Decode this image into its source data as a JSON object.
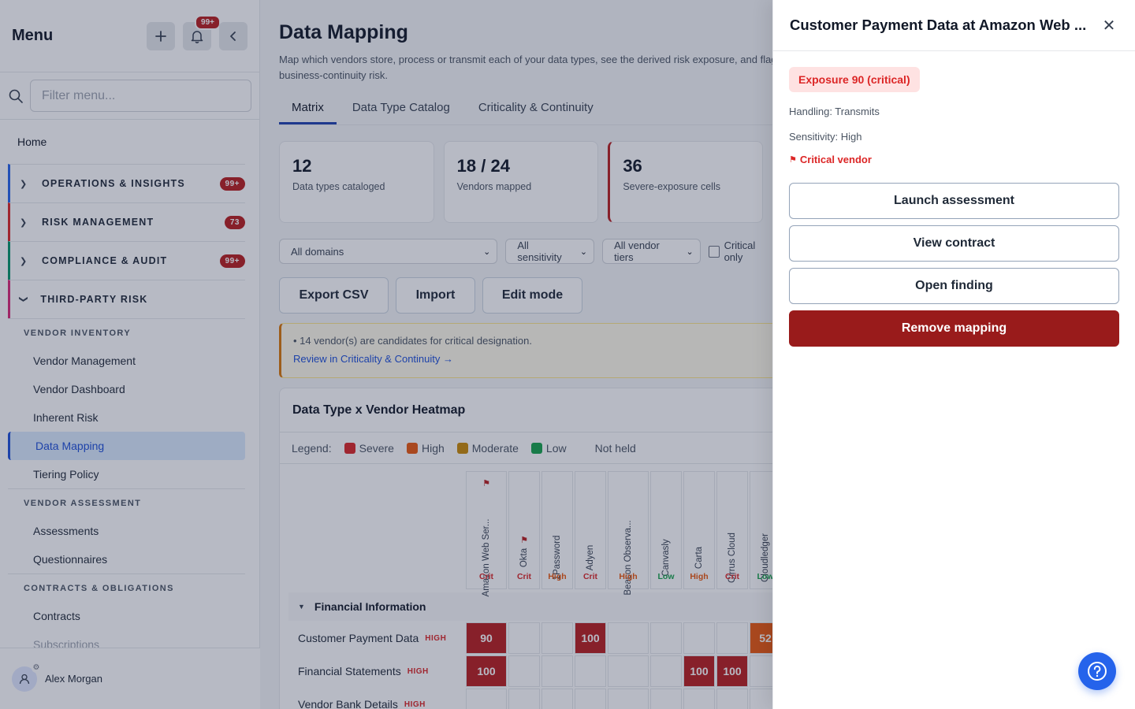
{
  "sidebar": {
    "title": "Menu",
    "notif_badge": "99+",
    "filter_placeholder": "Filter menu...",
    "home": "Home",
    "groups": [
      {
        "label": "OPERATIONS & INSIGHTS",
        "count": "99+",
        "color": "#2563eb",
        "expanded": false
      },
      {
        "label": "RISK MANAGEMENT",
        "count": "73",
        "color": "#dc2626",
        "expanded": false
      },
      {
        "label": "COMPLIANCE & AUDIT",
        "count": "99+",
        "color": "#059669",
        "expanded": false
      },
      {
        "label": "THIRD-PARTY RISK",
        "count": "",
        "color": "#db2777",
        "expanded": true
      }
    ],
    "sections": [
      {
        "label": "VENDOR INVENTORY",
        "items": [
          "Vendor Management",
          "Vendor Dashboard",
          "Inherent Risk",
          "Data Mapping",
          "Tiering Policy"
        ]
      },
      {
        "label": "VENDOR ASSESSMENT",
        "items": [
          "Assessments",
          "Questionnaires"
        ]
      },
      {
        "label": "CONTRACTS & OBLIGATIONS",
        "items": [
          "Contracts",
          "Subscriptions"
        ]
      }
    ],
    "active_item": "Data Mapping",
    "user": "Alex Morgan"
  },
  "main": {
    "title": "Data Mapping",
    "description": "Map which vendors store, process or transmit each of your data types, see the derived risk exposure, and flag business-continuity risk.",
    "tabs": [
      "Matrix",
      "Data Type Catalog",
      "Criticality & Continuity"
    ],
    "active_tab": "Matrix",
    "cards": [
      {
        "value": "12",
        "label": "Data types cataloged"
      },
      {
        "value": "18 / 24",
        "label": "Vendors mapped"
      },
      {
        "value": "36",
        "label": "Severe-exposure cells"
      }
    ],
    "filters": {
      "domains": "All domains",
      "sensitivity": "All sensitivity",
      "tiers": "All vendor tiers",
      "critical_only": "Critical only"
    },
    "actions": [
      "Export CSV",
      "Import",
      "Edit mode"
    ],
    "notice": {
      "text": "• 14 vendor(s) are candidates for critical designation.",
      "link": "Review in Criticality & Continuity →"
    },
    "heatmap": {
      "title": "Data Type x Vendor Heatmap",
      "legend_label": "Legend:",
      "legend": [
        {
          "label": "Severe",
          "color": "#dc2626"
        },
        {
          "label": "High",
          "color": "#ea580c"
        },
        {
          "label": "Moderate",
          "color": "#ca8a04"
        },
        {
          "label": "Low",
          "color": "#16a34a"
        },
        {
          "label": "Not held",
          "color": ""
        }
      ],
      "vendors": [
        {
          "name": "Amazon Web Ser...",
          "tier": "Crit",
          "flag": true
        },
        {
          "name": "Okta",
          "tier": "Crit",
          "flag": true
        },
        {
          "name": "1Password",
          "tier": "High",
          "flag": false
        },
        {
          "name": "Adyen",
          "tier": "Crit",
          "flag": false
        },
        {
          "name": "Beacon Observa...",
          "tier": "High",
          "flag": false
        },
        {
          "name": "Canvasly",
          "tier": "Low",
          "flag": false
        },
        {
          "name": "Carta",
          "tier": "High",
          "flag": false
        },
        {
          "name": "Cirrus Cloud",
          "tier": "Crit",
          "flag": false
        },
        {
          "name": "Cloudledger",
          "tier": "Low",
          "flag": false
        }
      ],
      "group": "Financial Information",
      "rows": [
        {
          "name": "Customer Payment Data",
          "sensitivity": "HIGH",
          "cells": [
            "90",
            "",
            "",
            "100",
            "",
            "",
            "",
            "",
            "52"
          ]
        },
        {
          "name": "Financial Statements",
          "sensitivity": "HIGH",
          "cells": [
            "100",
            "",
            "",
            "",
            "",
            "",
            "100",
            "100",
            ""
          ]
        },
        {
          "name": "Vendor Bank Details",
          "sensitivity": "HIGH",
          "cells": [
            "",
            "",
            "",
            "",
            "",
            "",
            "",
            "",
            ""
          ]
        }
      ]
    }
  },
  "drawer": {
    "title": "Customer Payment Data at Amazon Web ...",
    "exposure": "Exposure 90 (critical)",
    "handling": "Handling: Transmits",
    "sensitivity": "Sensitivity: High",
    "critical": "Critical vendor",
    "buttons": [
      "Launch assessment",
      "View contract",
      "Open finding"
    ],
    "danger_button": "Remove mapping"
  }
}
